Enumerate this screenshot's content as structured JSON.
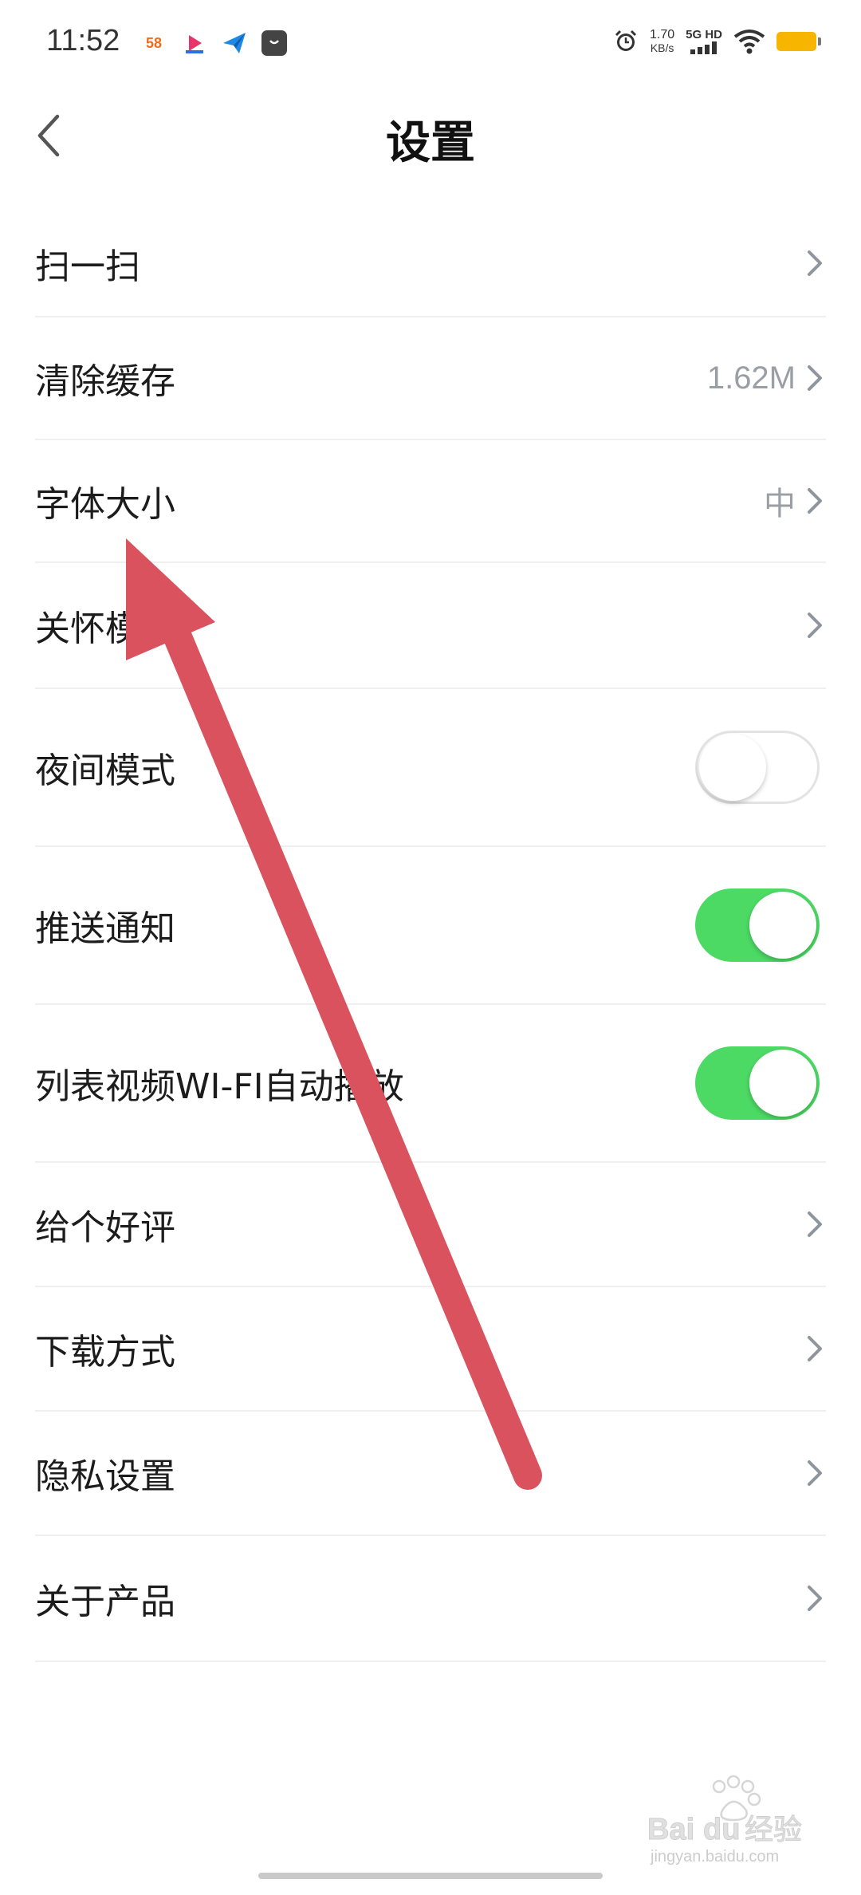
{
  "status_bar": {
    "time": "11:52",
    "app_58": "58",
    "net_speed_value": "1.70",
    "net_speed_unit": "KB/s",
    "net_type": "5G HD",
    "battery_color": "#f7b500"
  },
  "header": {
    "title": "设置"
  },
  "settings": {
    "scan": {
      "label": "扫一扫"
    },
    "clear_cache": {
      "label": "清除缓存",
      "value": "1.62M"
    },
    "font_size": {
      "label": "字体大小",
      "value": "中"
    },
    "care_mode": {
      "label": "关怀模式"
    },
    "night_mode": {
      "label": "夜间模式",
      "enabled": false
    },
    "push_notify": {
      "label": "推送通知",
      "enabled": true
    },
    "wifi_autoplay": {
      "label": "列表视频WI-FI自动播放",
      "enabled": true
    },
    "rate_us": {
      "label": "给个好评"
    },
    "download_method": {
      "label": "下载方式"
    },
    "privacy": {
      "label": "隐私设置"
    },
    "about": {
      "label": "关于产品"
    }
  },
  "colors": {
    "toggle_on": "#4cd964",
    "arrow": "#d9525e",
    "secondary_text": "#9a9fa6"
  },
  "watermark": {
    "brand": "Bai",
    "brand2": "经验",
    "url": "jingyan.baidu.com"
  }
}
